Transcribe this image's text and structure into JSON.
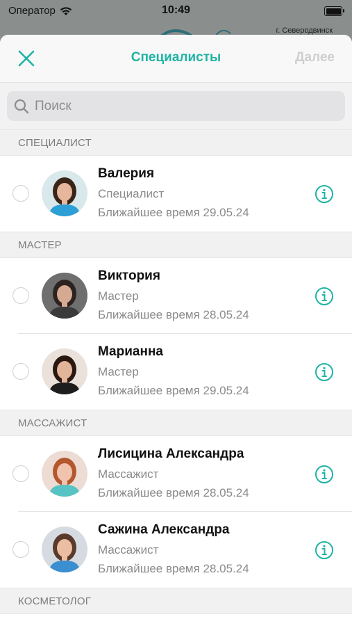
{
  "status": {
    "carrier": "Оператор",
    "time": "10:49"
  },
  "background": {
    "city": "г. Северодвинск"
  },
  "nav": {
    "title": "Специалисты",
    "next": "Далее"
  },
  "search": {
    "placeholder": "Поиск",
    "value": ""
  },
  "sections": [
    {
      "title": "СПЕЦИАЛИСТ",
      "items": [
        {
          "name": "Валерия",
          "role": "Специалист",
          "time": "Ближайшее время 29.05.24",
          "avatar": {
            "bg": "#d9e8ea",
            "skin": "#e6b79d",
            "hair": "#3a2418",
            "shirt": "#2c9fd6"
          }
        }
      ]
    },
    {
      "title": "МАСТЕР",
      "items": [
        {
          "name": "Виктория",
          "role": "Мастер",
          "time": "Ближайшее время 28.05.24",
          "avatar": {
            "bg": "#6f6f6f",
            "skin": "#d6aa92",
            "hair": "#2b2320",
            "shirt": "#3a3a3a"
          }
        },
        {
          "name": "Марианна",
          "role": "Мастер",
          "time": "Ближайшее время 29.05.24",
          "avatar": {
            "bg": "#e9e1da",
            "skin": "#e2b49a",
            "hair": "#2a1710",
            "shirt": "#1d1d1d"
          }
        }
      ]
    },
    {
      "title": "МАССАЖИСТ",
      "items": [
        {
          "name": "Лисицина Александра",
          "role": "Массажист",
          "time": "Ближайшее время 28.05.24",
          "avatar": {
            "bg": "#ecdcd4",
            "skin": "#efc3ad",
            "hair": "#b4572f",
            "shirt": "#58c3c4"
          }
        },
        {
          "name": "Сажина Александра",
          "role": "Массажист",
          "time": "Ближайшее время 28.05.24",
          "avatar": {
            "bg": "#d5dbe0",
            "skin": "#ebbea4",
            "hair": "#5a3a2a",
            "shirt": "#3b8fd1"
          }
        }
      ]
    },
    {
      "title": "КОСМЕТОЛОГ",
      "items": []
    }
  ],
  "colors": {
    "accent": "#1eb3a3",
    "disabled": "#cfcfcf"
  }
}
